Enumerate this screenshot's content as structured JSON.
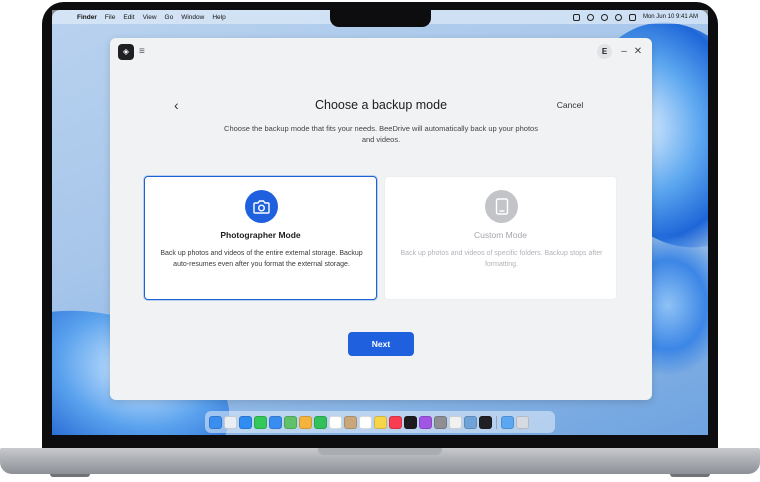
{
  "menubar": {
    "apple": "",
    "items": [
      "Finder",
      "File",
      "Edit",
      "View",
      "Go",
      "Window",
      "Help"
    ],
    "clock": "Mon Jun 10  9:41 AM"
  },
  "window": {
    "logo_glyph": "◈",
    "menu_glyph": "≡",
    "avatar_letter": "E",
    "minimize_glyph": "–",
    "close_glyph": "✕"
  },
  "dialog": {
    "back_glyph": "‹",
    "title": "Choose a backup mode",
    "cancel_label": "Cancel",
    "subtitle": "Choose the backup mode that fits your needs. BeeDrive will automatically back up your photos and videos."
  },
  "modes": [
    {
      "title": "Photographer Mode",
      "description": "Back up photos and videos of the entire external storage. Backup auto-resumes even after you format the external storage.",
      "icon": "camera-icon",
      "selected": true
    },
    {
      "title": "Custom Mode",
      "description": "Back up photos and videos of specific folders. Backup stops after formatting.",
      "icon": "tablet-icon",
      "selected": false
    }
  ],
  "next_label": "Next",
  "colors": {
    "accent": "#1f60df",
    "window_bg": "#f1f2f4",
    "disabled_icon": "#c2c4c8"
  },
  "dock_icons": [
    {
      "name": "finder-icon",
      "color": "#3b8ef0"
    },
    {
      "name": "launchpad-icon",
      "color": "#e9eef5"
    },
    {
      "name": "safari-icon",
      "color": "#2f8cf0"
    },
    {
      "name": "messages-icon",
      "color": "#34c759"
    },
    {
      "name": "mail-icon",
      "color": "#3a8df0"
    },
    {
      "name": "maps-icon",
      "color": "#5fc16a"
    },
    {
      "name": "photos-icon",
      "color": "#f4b33c"
    },
    {
      "name": "facetime-icon",
      "color": "#32c05a"
    },
    {
      "name": "calendar-icon",
      "color": "#ffffff"
    },
    {
      "name": "contacts-icon",
      "color": "#c9a77a"
    },
    {
      "name": "reminders-icon",
      "color": "#ffffff"
    },
    {
      "name": "notes-icon",
      "color": "#f7d54a"
    },
    {
      "name": "music-icon",
      "color": "#fa3c50"
    },
    {
      "name": "tv-icon",
      "color": "#1c1c1e"
    },
    {
      "name": "podcasts-icon",
      "color": "#a155e3"
    },
    {
      "name": "settings-icon",
      "color": "#8e8e93"
    },
    {
      "name": "textedit-icon",
      "color": "#f1f1f1"
    },
    {
      "name": "preview-icon",
      "color": "#6fa3d8"
    },
    {
      "name": "beedrive-icon",
      "color": "#1f1f24"
    },
    {
      "name": "folder-icon",
      "color": "#5ba7f2"
    },
    {
      "name": "trash-icon",
      "color": "#d6dbe2"
    }
  ]
}
